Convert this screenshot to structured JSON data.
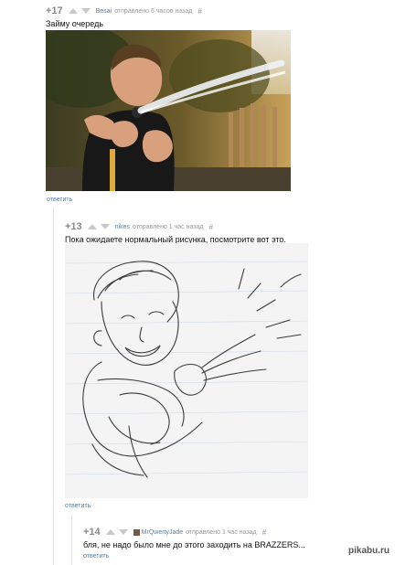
{
  "comments": [
    {
      "rating": "+17",
      "author": "Besai",
      "posted": "отправлено 6 часов назад",
      "hash": "#",
      "text": "Займу очередь",
      "reply": "ответить"
    },
    {
      "rating": "+13",
      "author": "nikes",
      "posted": "отправлено 1 час назад",
      "hash": "#",
      "text": "Пока ожидаете нормальный рисунка, посмотрите вот это.",
      "reply": "ответить"
    },
    {
      "rating": "+14",
      "author": "MrQwertyJade",
      "posted": "отправлено 1 час назад",
      "hash": "#",
      "text": "бля, не надо было мне до этого заходить на BRAZZERS...",
      "reply": "ответить"
    }
  ],
  "watermark": "pikabu.ru",
  "colors": {
    "link": "#5a7fa8",
    "rating": "#8a8a8a",
    "meta": "#9a9a9a"
  },
  "icons": {
    "vote_up": "triangle-up",
    "vote_down": "triangle-down"
  }
}
